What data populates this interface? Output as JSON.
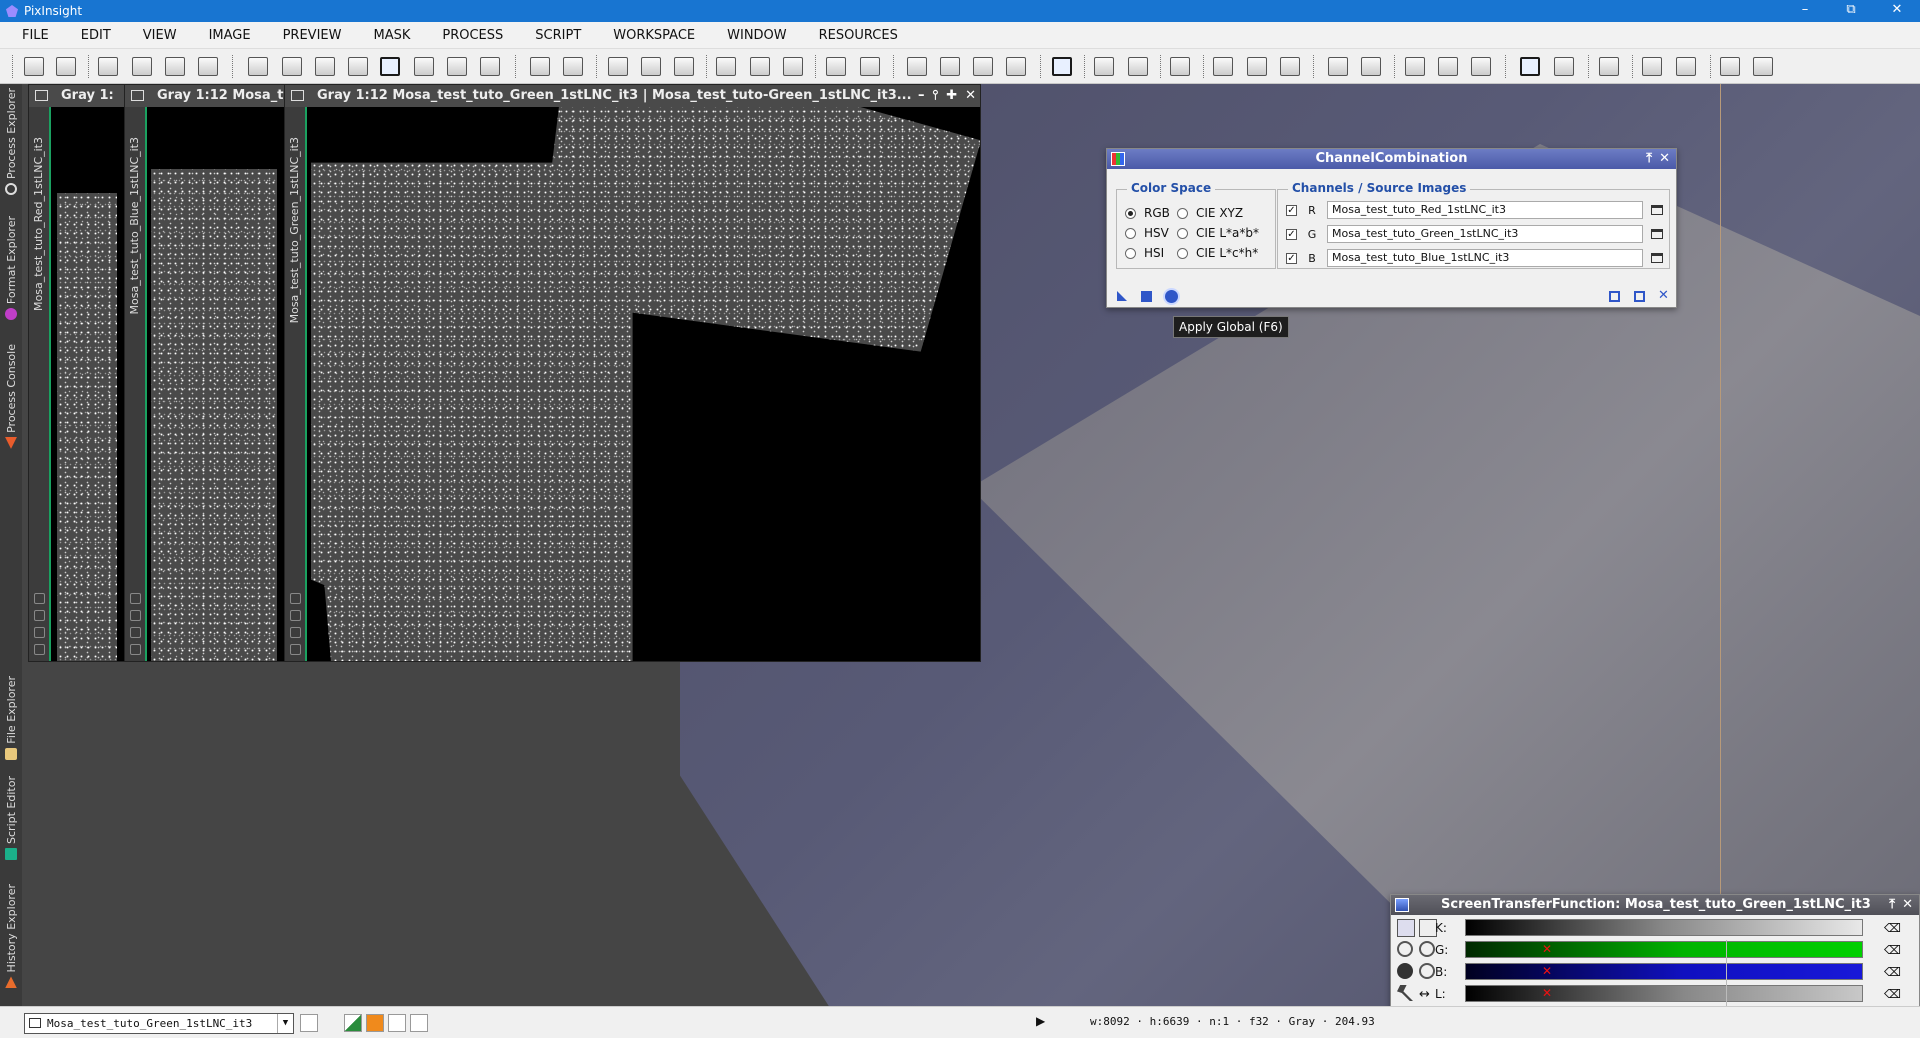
{
  "app": {
    "title": "PixInsight",
    "controls": [
      "–",
      "⧉",
      "✕"
    ]
  },
  "menu": [
    "FILE",
    "EDIT",
    "VIEW",
    "IMAGE",
    "PREVIEW",
    "MASK",
    "PROCESS",
    "SCRIPT",
    "WORKSPACE",
    "WINDOW",
    "RESOURCES"
  ],
  "sidebar": [
    {
      "label": "Process Explorer"
    },
    {
      "label": "Format Explorer"
    },
    {
      "label": "Process Console"
    },
    {
      "label": "File Explorer"
    },
    {
      "label": "Script Editor"
    },
    {
      "label": "History Explorer"
    }
  ],
  "image_windows": [
    {
      "title": "Gray 1:",
      "view": "Mosa_test_tuto_Red_1stLNC_it3"
    },
    {
      "title": "Gray 1:12 Mosa_t",
      "view": "Mosa_test_tuto_Blue_1stLNC_it3"
    },
    {
      "title": "Gray 1:12 Mosa_test_tuto_Green_1stLNC_it3 | Mosa_test_tuto-Green_1stLNC_it3...",
      "view": "Mosa_test_tuto_Green_1stLNC_it3",
      "buttons": [
        "–",
        "⫯",
        "✚",
        "✕"
      ]
    }
  ],
  "channel_combination": {
    "title": "ChannelCombination",
    "color_space": {
      "label": "Color Space",
      "options": [
        {
          "label": "RGB",
          "selected": true
        },
        {
          "label": "CIE XYZ",
          "selected": false
        },
        {
          "label": "HSV",
          "selected": false
        },
        {
          "label": "CIE L*a*b*",
          "selected": false
        },
        {
          "label": "HSI",
          "selected": false
        },
        {
          "label": "CIE L*c*h*",
          "selected": false
        }
      ]
    },
    "channels": {
      "label": "Channels / Source Images",
      "rows": [
        {
          "channel": "R",
          "image": "Mosa_test_tuto_Red_1stLNC_it3",
          "checked": true
        },
        {
          "channel": "G",
          "image": "Mosa_test_tuto_Green_1stLNC_it3",
          "checked": true
        },
        {
          "channel": "B",
          "image": "Mosa_test_tuto_Blue_1stLNC_it3",
          "checked": true
        }
      ]
    },
    "tooltip": "Apply Global (F6)"
  },
  "stf": {
    "title": "ScreenTransferFunction: Mosa_test_tuto_Green_1stLNC_it3",
    "channels": [
      {
        "label": "K:",
        "color": "#888888"
      },
      {
        "label": "G:",
        "color": "#00b400"
      },
      {
        "label": "B:",
        "color": "#1010c0"
      },
      {
        "label": "L:",
        "color": "#b0b0b0"
      }
    ]
  },
  "status": {
    "view": "Mosa_test_tuto_Green_1stLNC_it3",
    "info": "w:8092 · h:6639 · n:1 · f32 · Gray · 204.93"
  }
}
